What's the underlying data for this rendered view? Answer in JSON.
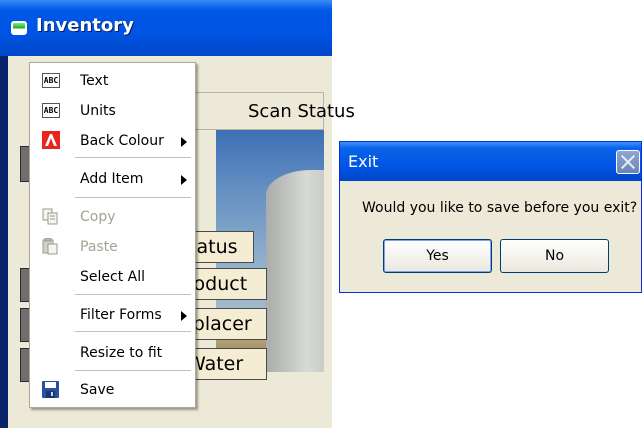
{
  "inventory_window": {
    "title": "Inventory",
    "scan_status_label": "Scan Status",
    "fields": [
      "Status",
      "Product",
      "Displacer",
      "Water"
    ]
  },
  "context_menu": {
    "items": [
      {
        "label": "Text",
        "icon": "abc-icon",
        "enabled": true,
        "submenu": false
      },
      {
        "label": "Units",
        "icon": "abc-icon",
        "enabled": true,
        "submenu": false
      },
      {
        "label": "Back Colour",
        "icon": "font-color-icon",
        "enabled": true,
        "submenu": true
      },
      {
        "label": "Add Item",
        "icon": "",
        "enabled": true,
        "submenu": true
      },
      {
        "label": "Copy",
        "icon": "copy-icon",
        "enabled": false,
        "submenu": false
      },
      {
        "label": "Paste",
        "icon": "paste-icon",
        "enabled": false,
        "submenu": false
      },
      {
        "label": "Select All",
        "icon": "",
        "enabled": true,
        "submenu": false
      },
      {
        "label": "Filter Forms",
        "icon": "",
        "enabled": true,
        "submenu": true
      },
      {
        "label": "Resize to fit",
        "icon": "",
        "enabled": true,
        "submenu": false
      },
      {
        "label": "Save",
        "icon": "floppy-disk-icon",
        "enabled": true,
        "submenu": false
      }
    ],
    "abc_icon_text": "ABC"
  },
  "exit_dialog": {
    "title": "Exit",
    "message": "Would you like to save before you exit?",
    "yes_label": "Yes",
    "no_label": "No"
  },
  "colors": {
    "titlebar_blue": "#0054e3",
    "window_face": "#ece9d8",
    "field_label_bg": "#f4edd3"
  }
}
